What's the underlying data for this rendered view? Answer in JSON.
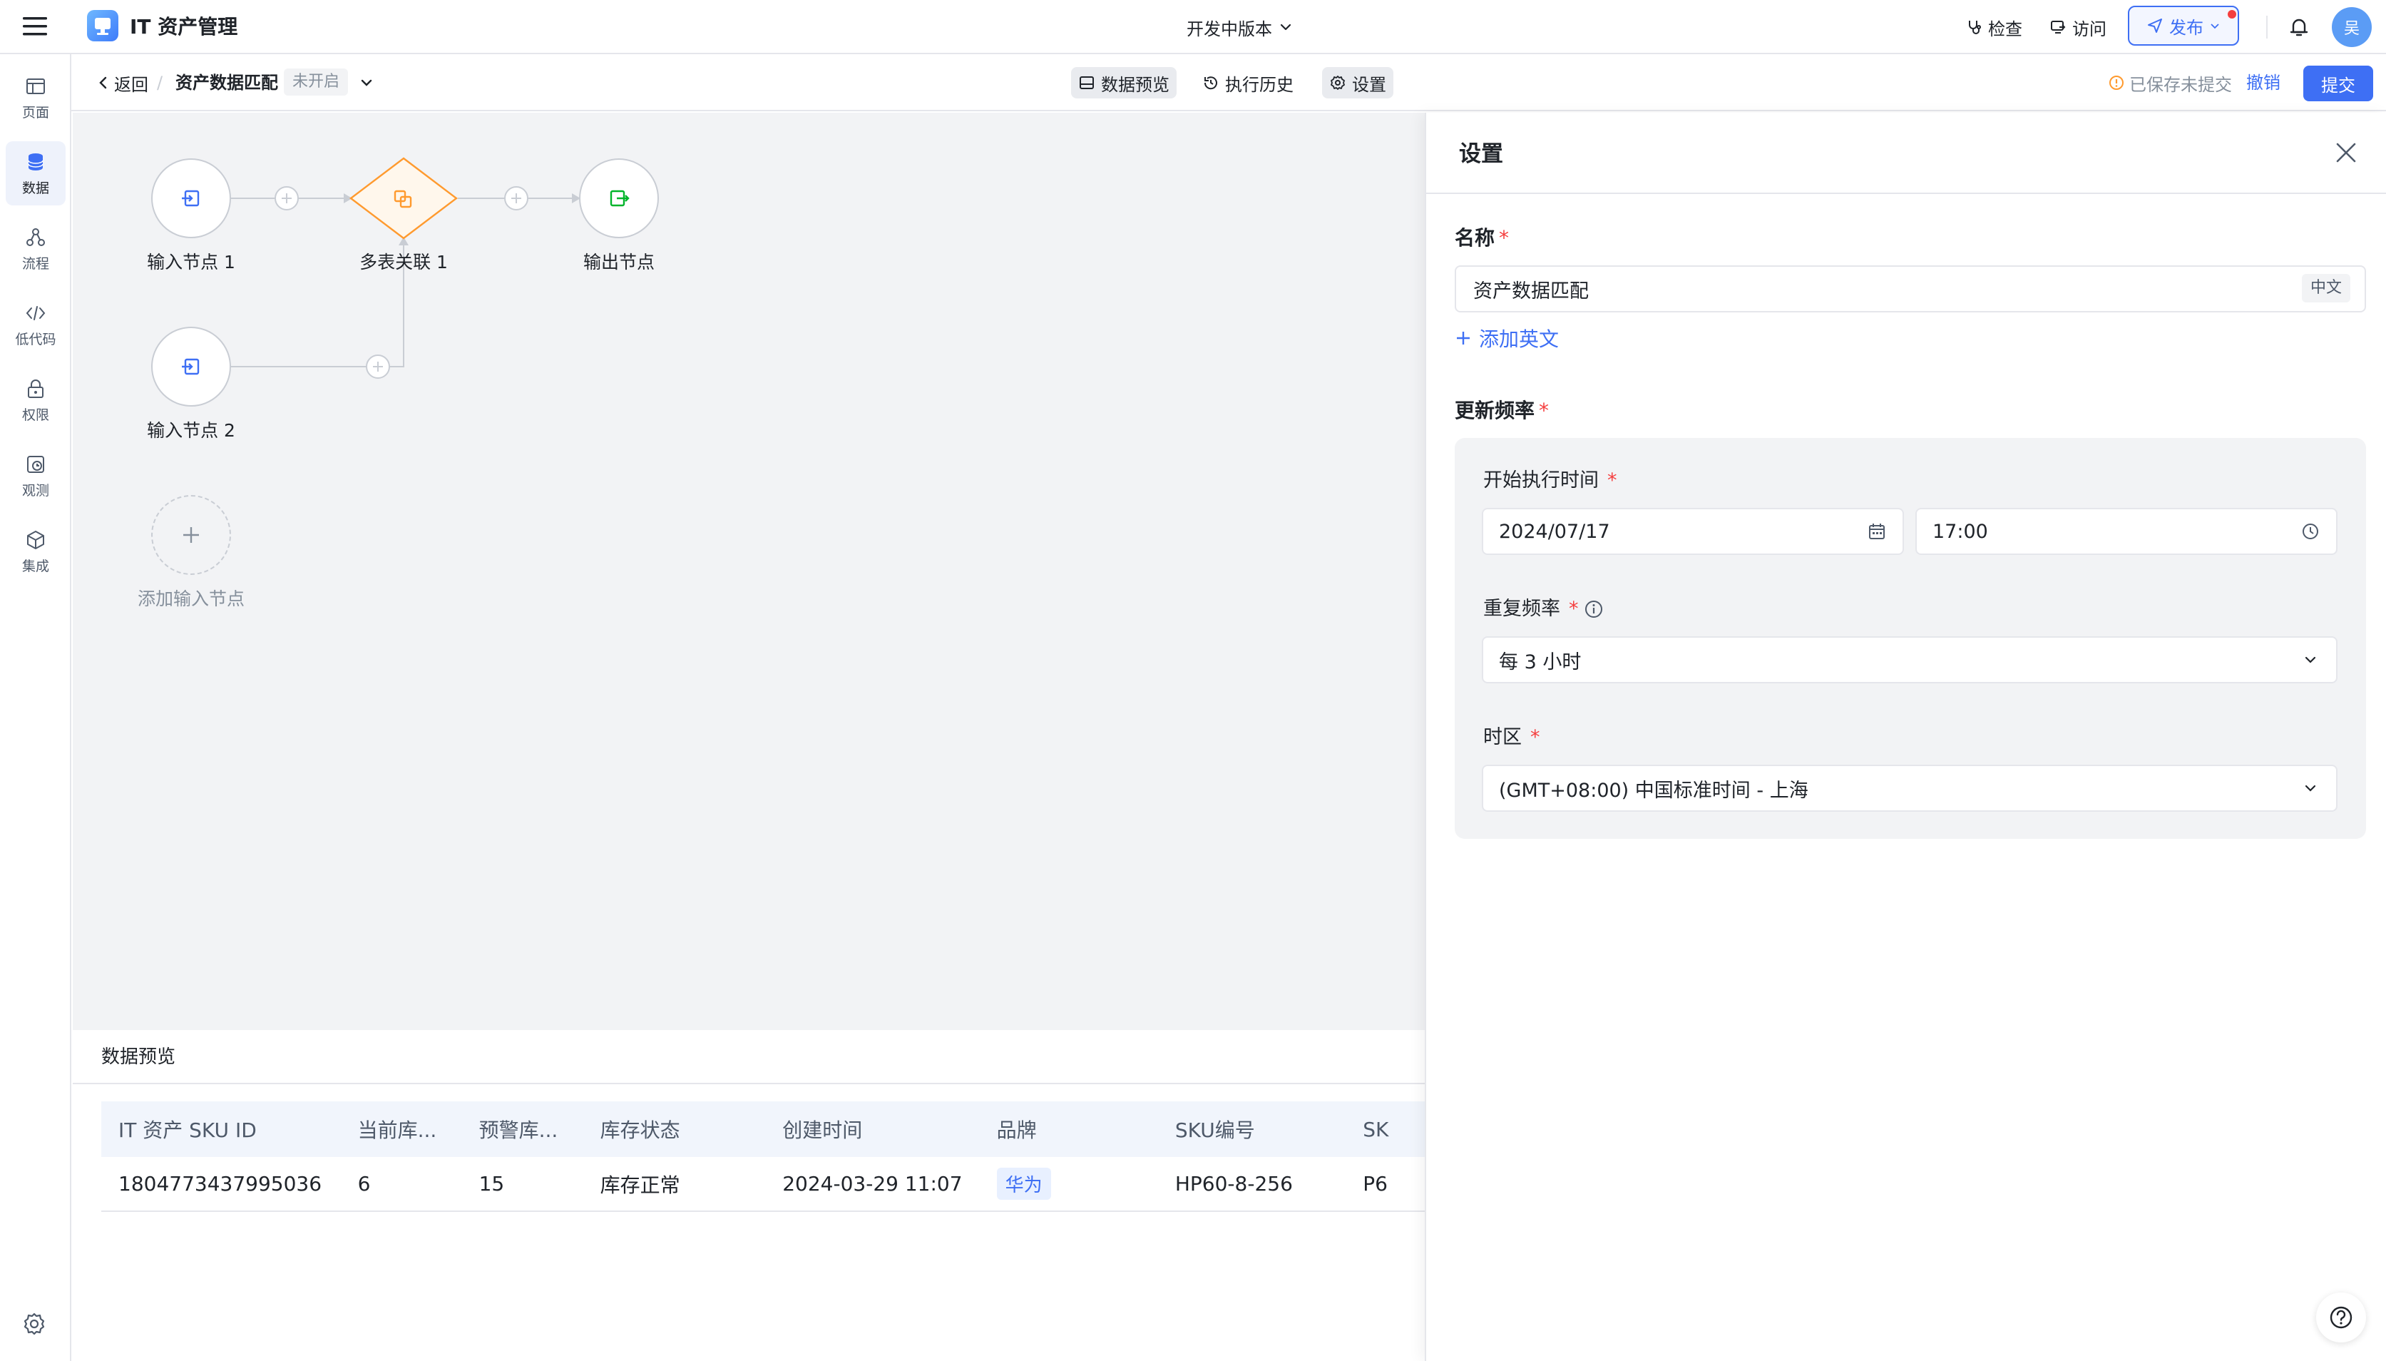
{
  "app": {
    "title": "IT 资产管理",
    "version": "开发中版本",
    "check": "检查",
    "visit": "访问",
    "publish": "发布",
    "avatar": "吴",
    "accent": "#3e6ff4"
  },
  "sidebar": {
    "items": [
      {
        "label": "页面",
        "icon": "page-icon"
      },
      {
        "label": "数据",
        "icon": "database-icon"
      },
      {
        "label": "流程",
        "icon": "flow-icon"
      },
      {
        "label": "低代码",
        "icon": "code-icon"
      },
      {
        "label": "权限",
        "icon": "lock-icon"
      },
      {
        "label": "观测",
        "icon": "monitor-icon"
      },
      {
        "label": "集成",
        "icon": "cube-icon"
      }
    ],
    "active_index": 1
  },
  "subheader": {
    "back": "返回",
    "separator": "/",
    "name": "资产数据匹配",
    "status": "未开启",
    "tabs": [
      "数据预览",
      "执行历史",
      "设置"
    ],
    "save_status": "已保存未提交",
    "undo": "撤销",
    "submit": "提交"
  },
  "canvas": {
    "nodes": [
      {
        "id": "input1",
        "label": "输入节点 1",
        "icon": "input-icon"
      },
      {
        "id": "join1",
        "label": "多表关联 1",
        "icon": "join-icon"
      },
      {
        "id": "output",
        "label": "输出节点",
        "icon": "output-icon"
      },
      {
        "id": "input2",
        "label": "输入节点 2",
        "icon": "input-icon"
      }
    ],
    "add_input": "添加输入节点"
  },
  "preview": {
    "title": "数据预览",
    "columns": [
      "IT 资产 SKU ID",
      "当前库...",
      "预警库...",
      "库存状态",
      "创建时间",
      "品牌",
      "SKU编号",
      "SK"
    ],
    "rows": [
      {
        "sku_id": "1804773437995036",
        "current": "6",
        "warning": "15",
        "status": "库存正常",
        "created": "2024-03-29 11:07",
        "brand": "华为",
        "sku_no": "HP60-8-256",
        "extra": "P6"
      }
    ]
  },
  "settings": {
    "title": "设置",
    "name_label": "名称",
    "name_value": "资产数据匹配",
    "name_lang": "中文",
    "add_english": "添加英文",
    "freq_label": "更新频率",
    "start_label": "开始执行时间",
    "start_date": "2024/07/17",
    "start_time": "17:00",
    "repeat_label": "重复频率",
    "repeat_value": "每 3 小时",
    "tz_label": "时区",
    "tz_value": "(GMT+08:00) 中国标准时间 - 上海"
  }
}
